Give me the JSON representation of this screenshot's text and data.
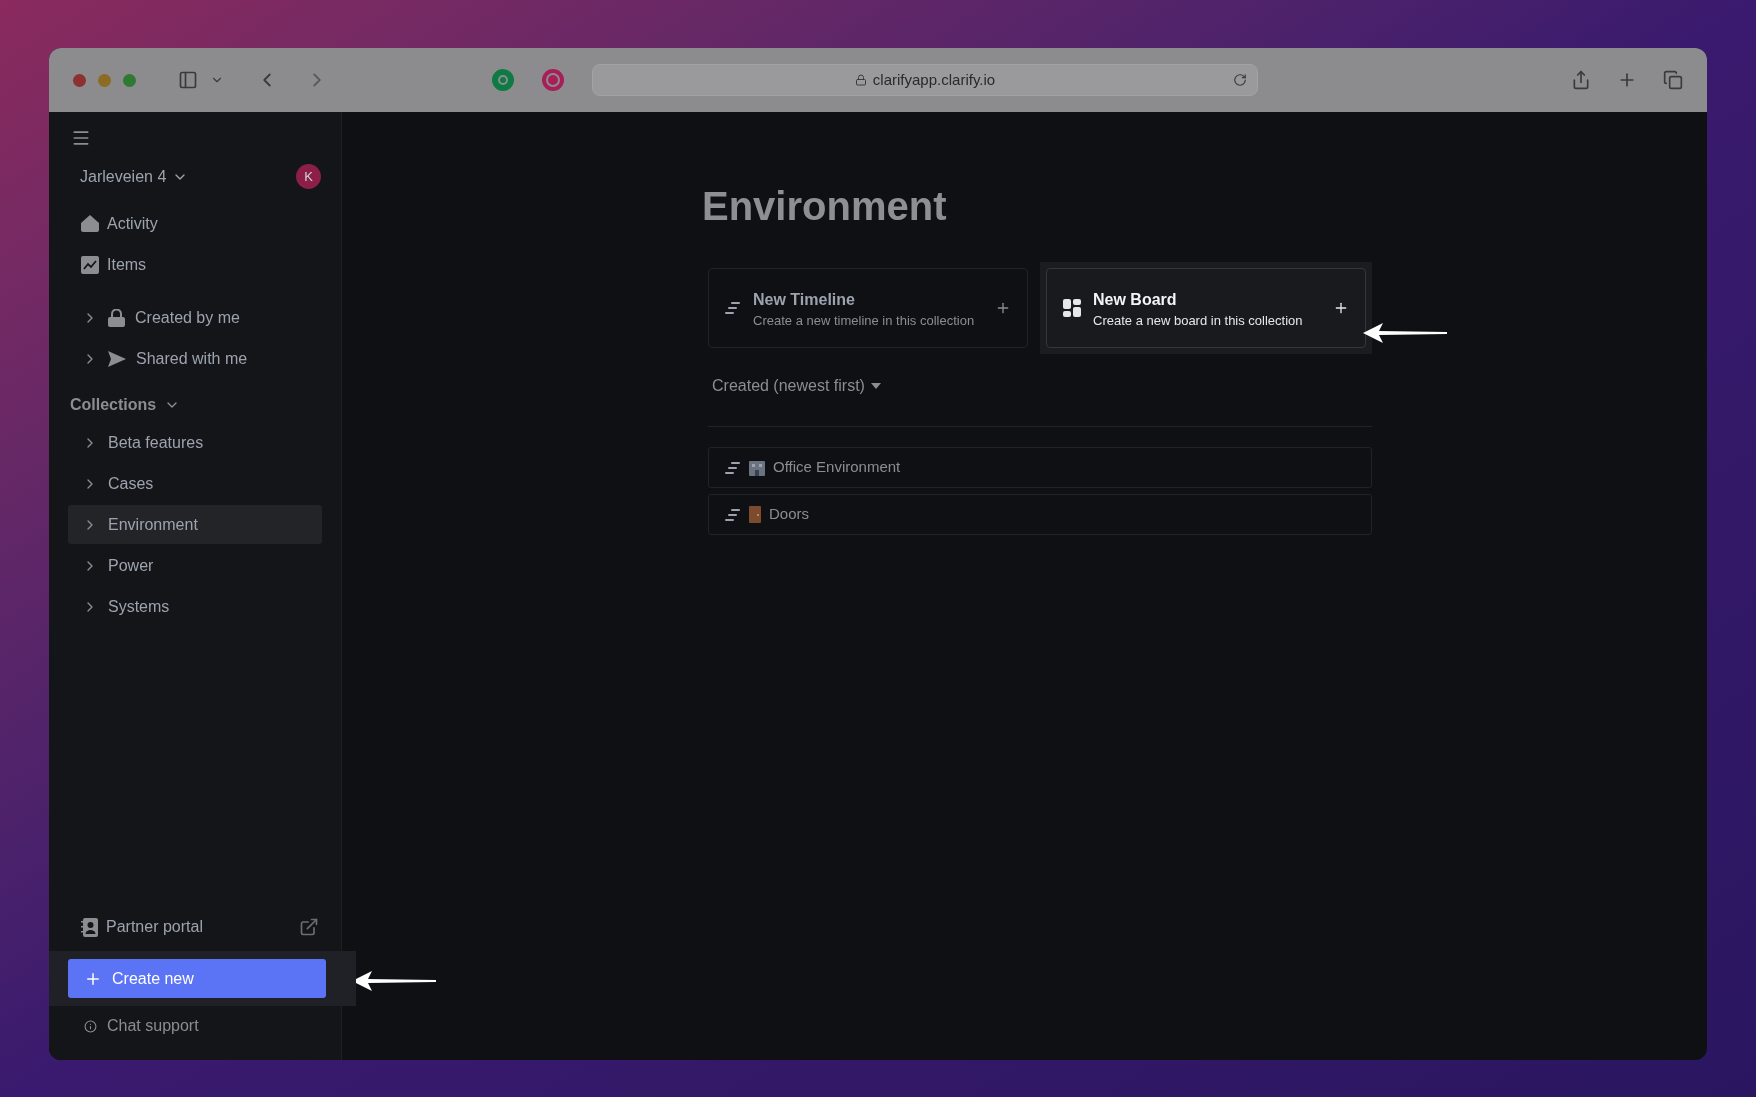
{
  "browser": {
    "url": "clarifyapp.clarify.io"
  },
  "sidebar": {
    "workspace": "Jarleveien 4",
    "avatar_initial": "K",
    "nav": [
      {
        "label": "Activity"
      },
      {
        "label": "Items"
      }
    ],
    "shared": [
      {
        "label": "Created by me",
        "expanded": false
      },
      {
        "label": "Shared with me",
        "expanded": false
      }
    ],
    "collections_heading": "Collections",
    "collections": [
      {
        "label": "Beta features",
        "selected": false
      },
      {
        "label": "Cases",
        "selected": false
      },
      {
        "label": "Environment",
        "selected": true
      },
      {
        "label": "Power",
        "selected": false
      },
      {
        "label": "Systems",
        "selected": false
      }
    ],
    "partner_portal": "Partner portal",
    "create_new": {
      "label": "Create new",
      "highlighted": true
    },
    "chat_support": "Chat support"
  },
  "main": {
    "title": "Environment",
    "create_cards": [
      {
        "title": "New Timeline",
        "description": "Create a new timeline in this collection",
        "highlighted": false
      },
      {
        "title": "New Board",
        "description": "Create a new board in this collection",
        "highlighted": true
      }
    ],
    "sort": "Created (newest first)",
    "items": [
      {
        "label": "Office Environment"
      },
      {
        "label": "Doors"
      }
    ]
  }
}
